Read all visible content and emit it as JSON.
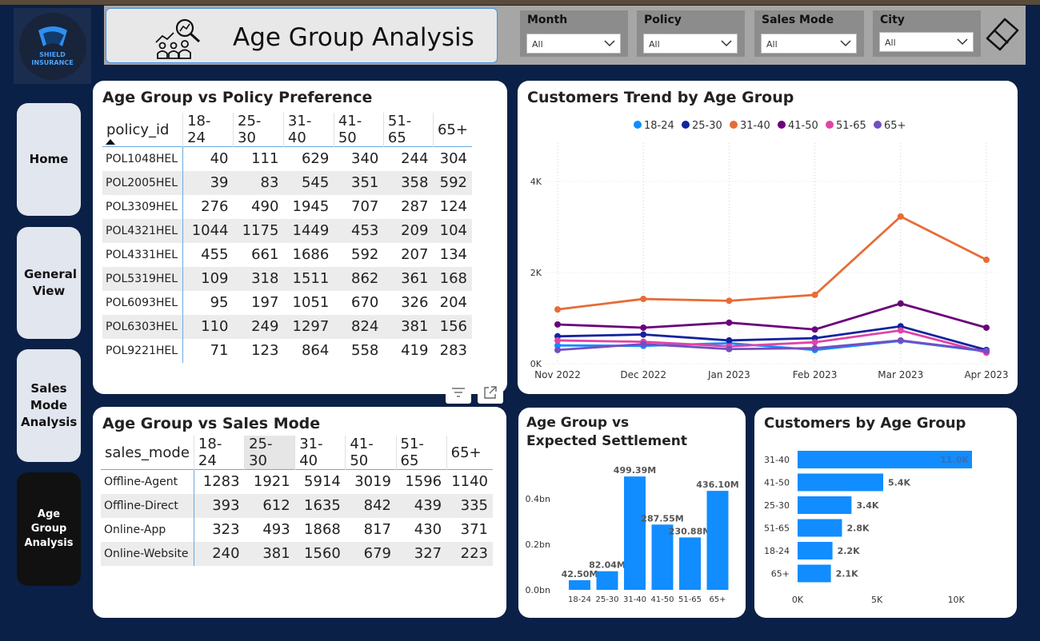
{
  "header": {
    "title": "Age Group Analysis",
    "logo_text_line1": "SHIELD",
    "logo_text_line2": "INSURANCE"
  },
  "slicers": [
    {
      "label": "Month",
      "value": "All"
    },
    {
      "label": "Policy",
      "value": "All"
    },
    {
      "label": "Sales Mode",
      "value": "All"
    },
    {
      "label": "City",
      "value": "All"
    }
  ],
  "nav": {
    "home": "Home",
    "general_view": "General View",
    "sales_mode_analysis": "Sales Mode Analysis",
    "age_group_analysis": "Age Group Analysis"
  },
  "policy_table": {
    "title": "Age Group vs Policy Preference",
    "row_header": "policy_id",
    "columns": [
      "18-24",
      "25-30",
      "31-40",
      "41-50",
      "51-65",
      "65+"
    ],
    "rows": [
      {
        "id": "POL1048HEL",
        "values": [
          40,
          111,
          629,
          340,
          244,
          304
        ]
      },
      {
        "id": "POL2005HEL",
        "values": [
          39,
          83,
          545,
          351,
          358,
          592
        ]
      },
      {
        "id": "POL3309HEL",
        "values": [
          276,
          490,
          1945,
          707,
          287,
          124
        ]
      },
      {
        "id": "POL4321HEL",
        "values": [
          1044,
          1175,
          1449,
          453,
          209,
          104
        ]
      },
      {
        "id": "POL4331HEL",
        "values": [
          455,
          661,
          1686,
          592,
          207,
          134
        ]
      },
      {
        "id": "POL5319HEL",
        "values": [
          109,
          318,
          1511,
          862,
          361,
          168
        ]
      },
      {
        "id": "POL6093HEL",
        "values": [
          95,
          197,
          1051,
          670,
          326,
          204
        ]
      },
      {
        "id": "POL6303HEL",
        "values": [
          110,
          249,
          1297,
          824,
          381,
          156
        ]
      },
      {
        "id": "POL9221HEL",
        "values": [
          71,
          123,
          864,
          558,
          419,
          283
        ]
      }
    ]
  },
  "sales_table": {
    "title": "Age Group vs Sales Mode",
    "row_header": "sales_mode",
    "columns": [
      "18-24",
      "25-30",
      "31-40",
      "41-50",
      "51-65",
      "65+"
    ],
    "rows": [
      {
        "id": "Offline-Agent",
        "values": [
          1283,
          1921,
          5914,
          3019,
          1596,
          1140
        ]
      },
      {
        "id": "Offline-Direct",
        "values": [
          393,
          612,
          1635,
          842,
          439,
          335
        ]
      },
      {
        "id": "Online-App",
        "values": [
          323,
          493,
          1868,
          817,
          430,
          371
        ]
      },
      {
        "id": "Online-Website",
        "values": [
          240,
          381,
          1560,
          679,
          327,
          223
        ]
      }
    ]
  },
  "chart_data": [
    {
      "type": "line",
      "title": "Customers Trend by Age Group",
      "x": [
        "Nov 2022",
        "Dec 2022",
        "Jan 2023",
        "Feb 2023",
        "Mar 2023",
        "Apr 2023"
      ],
      "yticks": [
        "0K",
        "2K",
        "4K"
      ],
      "ylim": [
        0,
        4000
      ],
      "grid": true,
      "legend": "top-center",
      "series": [
        {
          "name": "18-24",
          "color": "#118dff",
          "values": [
            400,
            390,
            450,
            300,
            500,
            270
          ]
        },
        {
          "name": "25-30",
          "color": "#12239e",
          "values": [
            600,
            640,
            510,
            560,
            820,
            300
          ]
        },
        {
          "name": "31-40",
          "color": "#e66c37",
          "values": [
            1190,
            1420,
            1380,
            1510,
            3230,
            2280
          ]
        },
        {
          "name": "41-50",
          "color": "#6b007b",
          "values": [
            860,
            790,
            900,
            750,
            1320,
            790
          ]
        },
        {
          "name": "51-65",
          "color": "#e044a7",
          "values": [
            510,
            480,
            380,
            470,
            730,
            240
          ]
        },
        {
          "name": "65+",
          "color": "#744ec2",
          "values": [
            300,
            430,
            320,
            340,
            510,
            280
          ]
        }
      ]
    },
    {
      "type": "bar",
      "title": "Age Group vs Expected Settlement",
      "categories": [
        "18-24",
        "25-30",
        "31-40",
        "41-50",
        "51-65",
        "65+"
      ],
      "values": [
        42.5,
        82.04,
        499.39,
        287.55,
        230.88,
        436.1
      ],
      "labels": [
        "42.50M",
        "82.04M",
        "499.39M",
        "287.55M",
        "230.88M",
        "436.10M"
      ],
      "yticks": [
        "0.0bn",
        "0.2bn",
        "0.4bn"
      ],
      "ylim": [
        0,
        500
      ],
      "color": "#118dff"
    },
    {
      "type": "bar",
      "orientation": "horizontal",
      "title": "Customers by Age Group",
      "categories": [
        "31-40",
        "41-50",
        "25-30",
        "51-65",
        "18-24",
        "65+"
      ],
      "values": [
        11000,
        5400,
        3400,
        2800,
        2200,
        2100
      ],
      "labels": [
        "11.0K",
        "5.4K",
        "3.4K",
        "2.8K",
        "2.2K",
        "2.1K"
      ],
      "xticks": [
        "0K",
        "5K",
        "10K"
      ],
      "xlim": [
        0,
        11000
      ],
      "color": "#118dff"
    }
  ]
}
